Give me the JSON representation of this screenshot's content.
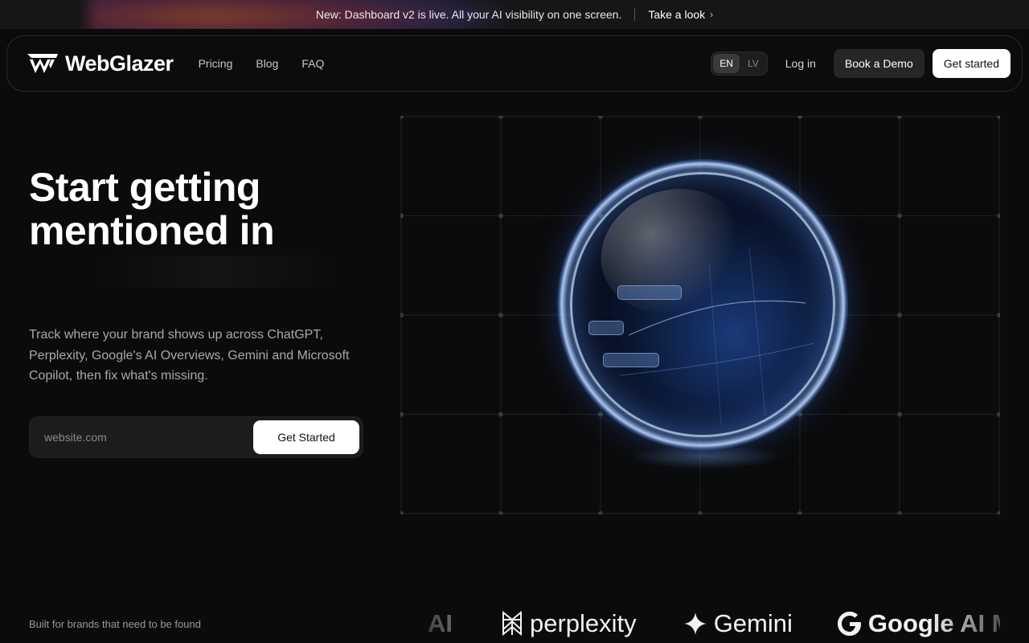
{
  "announcement": {
    "text": "New: Dashboard v2 is live. All your AI visibility on one screen.",
    "link_label": "Take a look",
    "link_icon": "chevron-right-icon"
  },
  "nav": {
    "brand": "WebGlazer",
    "logo_icon": "webglazer-logo-icon",
    "links": [
      "Pricing",
      "Blog",
      "FAQ"
    ],
    "languages": [
      "EN",
      "LV"
    ],
    "active_language": "EN",
    "login": "Log in",
    "demo_button": "Book a Demo",
    "cta_button": "Get started"
  },
  "hero": {
    "title_line1": "Start getting",
    "title_line2": "mentioned in",
    "subtitle": "Track where your brand shows up across ChatGPT, Perplexity, Google's AI Overviews, Gemini and Microsoft Copilot, then fix what's missing.",
    "input_placeholder": "website.com",
    "submit_label": "Get Started"
  },
  "logo_strip": {
    "caption": "Built for brands that need to be found",
    "logos": [
      {
        "name": "AI",
        "icon": ""
      },
      {
        "name": "perplexity",
        "icon": "perplexity-icon"
      },
      {
        "name": "Gemini",
        "icon": "gemini-sparkle-icon"
      },
      {
        "name": "Google AI M",
        "icon": "google-g-icon"
      }
    ]
  },
  "colors": {
    "background": "#0b0b0b",
    "primary_button": "#ffffff",
    "secondary_button": "#262626",
    "orb_accent": "#4a86ff"
  }
}
